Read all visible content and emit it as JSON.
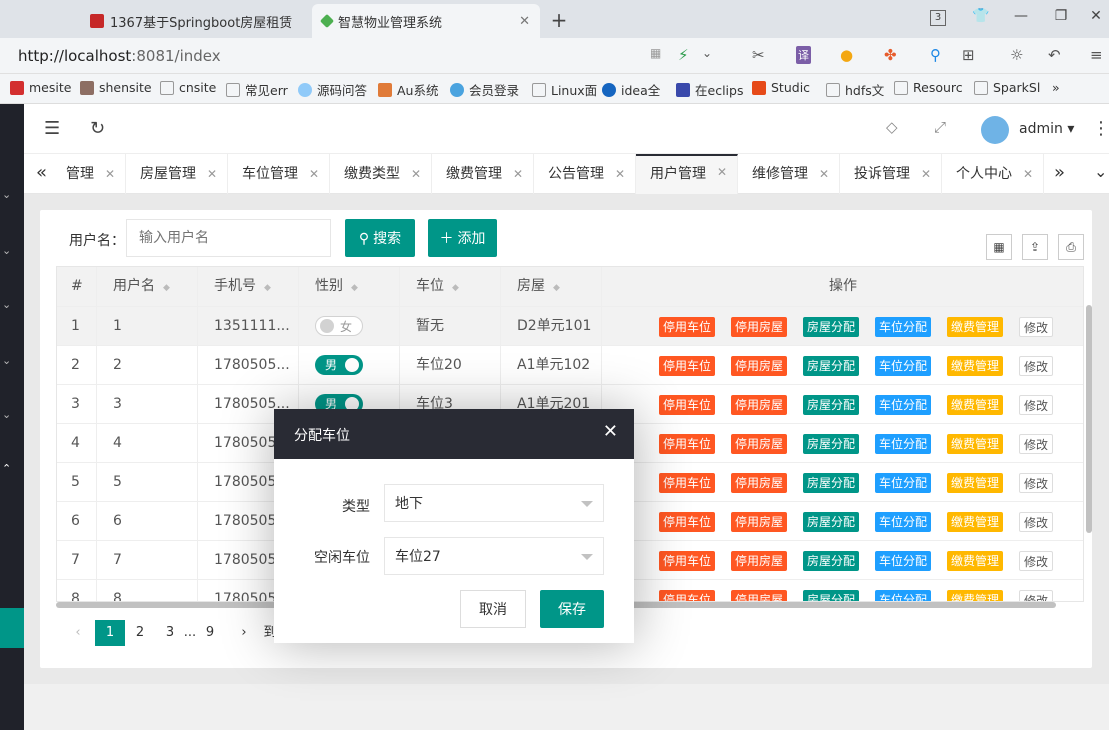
{
  "browser": {
    "tabs": [
      {
        "title": "1367基于Springboot房屋租赁",
        "favicon_color": "#c62828"
      },
      {
        "title": "智慧物业管理系统",
        "favicon_color": "#2e7d32"
      }
    ],
    "new_tab": "+",
    "tab_count": "3",
    "url_prefix": "http://localhost",
    "url_suffix": ":8081/index",
    "bookmarks": [
      "mesite",
      "shensite",
      "cnsite",
      "常见err",
      "源码问答",
      "Au系统",
      "会员登录",
      "Linux面",
      "idea全",
      "在eclips",
      "Studic",
      "hdfs文",
      "Resourc",
      "SparkSl"
    ],
    "bookmark_more": "»"
  },
  "header": {
    "username": "admin"
  },
  "nav_tabs": [
    {
      "label": "管理",
      "active": false
    },
    {
      "label": "房屋管理",
      "active": false
    },
    {
      "label": "车位管理",
      "active": false
    },
    {
      "label": "缴费类型",
      "active": false
    },
    {
      "label": "缴费管理",
      "active": false
    },
    {
      "label": "公告管理",
      "active": false
    },
    {
      "label": "用户管理",
      "active": true
    },
    {
      "label": "维修管理",
      "active": false
    },
    {
      "label": "投诉管理",
      "active": false
    },
    {
      "label": "个人中心",
      "active": false
    }
  ],
  "search": {
    "label": "用户名：",
    "placeholder": "输入用户名",
    "search_button": "搜索",
    "add_button": "添加"
  },
  "table": {
    "headers": [
      "#",
      "用户名",
      "手机号",
      "性别",
      "车位",
      "房屋",
      "操作"
    ],
    "rows": [
      {
        "no": "1",
        "username": "1",
        "phone": "1351111...",
        "gender": "女",
        "gender_on": false,
        "parking": "暂无",
        "house": "D2单元101"
      },
      {
        "no": "2",
        "username": "2",
        "phone": "1780505...",
        "gender": "男",
        "gender_on": true,
        "parking": "车位20",
        "house": "A1单元102"
      },
      {
        "no": "3",
        "username": "3",
        "phone": "1780505...",
        "gender": "男",
        "gender_on": true,
        "parking": "车位3",
        "house": "A1单元201"
      },
      {
        "no": "4",
        "username": "4",
        "phone": "1780505..",
        "gender": "",
        "gender_on": true,
        "parking": "",
        "house": ""
      },
      {
        "no": "5",
        "username": "5",
        "phone": "1780505.",
        "gender": "",
        "gender_on": true,
        "parking": "",
        "house": ""
      },
      {
        "no": "6",
        "username": "6",
        "phone": "1780505.",
        "gender": "",
        "gender_on": true,
        "parking": "",
        "house": ""
      },
      {
        "no": "7",
        "username": "7",
        "phone": "1780505.",
        "gender": "",
        "gender_on": true,
        "parking": "",
        "house": ""
      },
      {
        "no": "8",
        "username": "8",
        "phone": "1780505.",
        "gender": "",
        "gender_on": true,
        "parking": "",
        "house": ""
      }
    ],
    "actions": [
      "停用车位",
      "停用房屋",
      "房屋分配",
      "车位分配",
      "缴费管理",
      "修改"
    ]
  },
  "pagination": {
    "pages": [
      "1",
      "2",
      "3",
      "...",
      "9"
    ],
    "current": "1",
    "goto_label": "到"
  },
  "modal": {
    "title": "分配车位",
    "type_label": "类型",
    "type_value": "地下",
    "space_label": "空闲车位",
    "space_value": "车位27",
    "cancel": "取消",
    "save": "保存"
  }
}
